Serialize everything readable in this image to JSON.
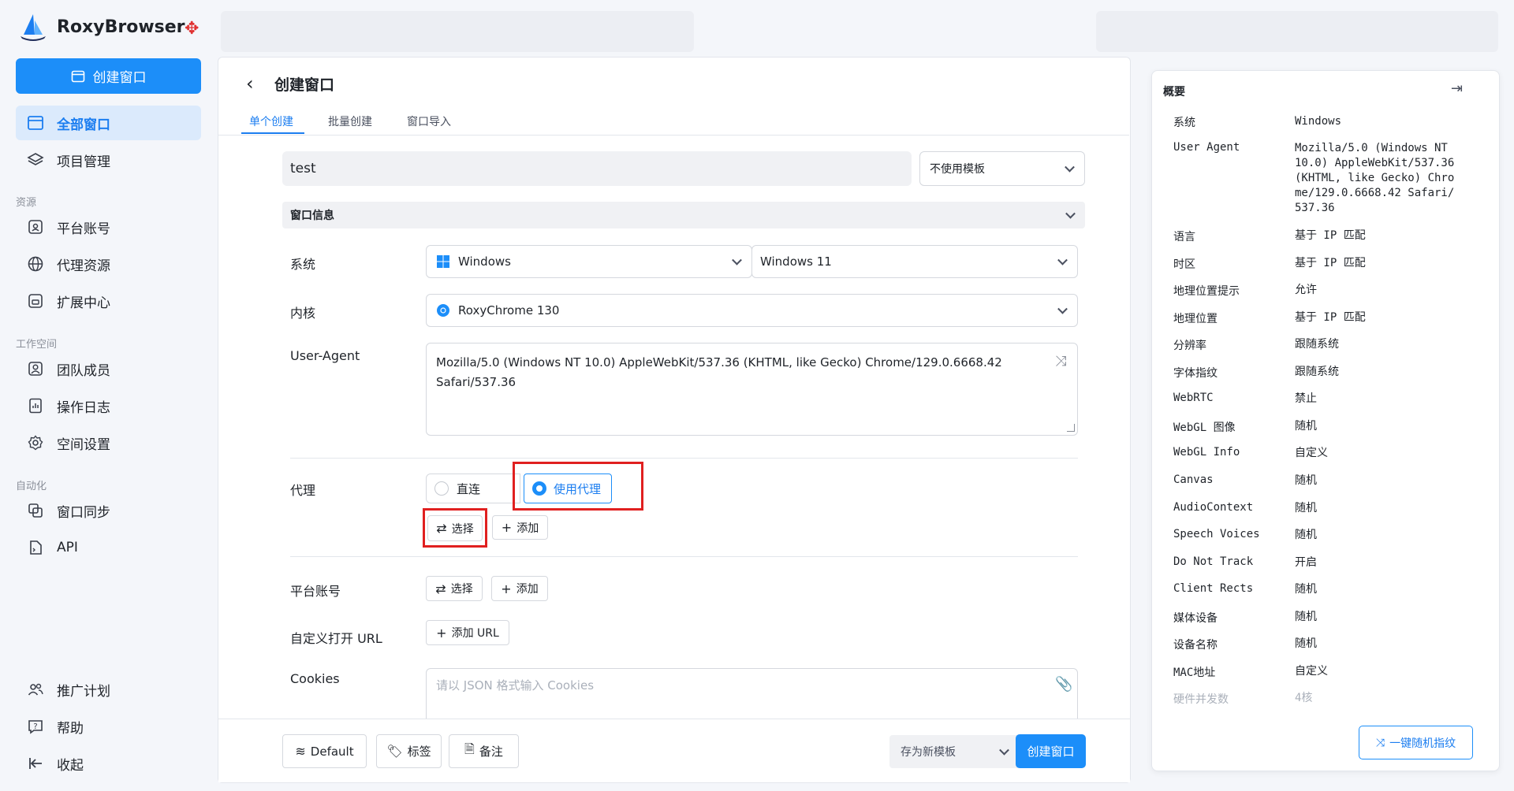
{
  "app": {
    "brand": "RoxyBrowser"
  },
  "sidebar": {
    "create_label": "创建窗口",
    "items": [
      {
        "label": "全部窗口"
      },
      {
        "label": "项目管理"
      },
      {
        "label": "平台账号"
      },
      {
        "label": "代理资源"
      },
      {
        "label": "扩展中心"
      },
      {
        "label": "团队成员"
      },
      {
        "label": "操作日志"
      },
      {
        "label": "空间设置"
      },
      {
        "label": "窗口同步"
      },
      {
        "label": "API"
      },
      {
        "label": "推广计划"
      },
      {
        "label": "帮助"
      },
      {
        "label": "收起"
      }
    ],
    "sections": [
      "资源",
      "工作空间",
      "自动化"
    ]
  },
  "page": {
    "title": "创建窗口",
    "tabs": [
      "单个创建",
      "批量创建",
      "窗口导入"
    ]
  },
  "form": {
    "name_value": "test",
    "template": "不使用模板",
    "section_title": "窗口信息",
    "labels": {
      "system": "系统",
      "kernel": "内核",
      "ua": "User-Agent",
      "proxy": "代理",
      "platform": "平台账号",
      "url": "自定义打开 URL",
      "cookies": "Cookies"
    },
    "os": "Windows",
    "os_version": "Windows 11",
    "kernel": "RoxyChrome 130",
    "ua_value": "Mozilla/5.0 (Windows NT 10.0) AppleWebKit/537.36 (KHTML, like Gecko) Chrome/129.0.6668.42 Safari/537.36",
    "proxy_direct": "直连",
    "proxy_use": "使用代理",
    "select_label": "选择",
    "add_label": "添加",
    "add_url_label": "添加 URL",
    "cookies_placeholder": "请以 JSON 格式输入 Cookies"
  },
  "footer": {
    "default_label": "Default",
    "tag_label": "标签",
    "note_label": "备注",
    "save_template": "存为新模板",
    "create_label": "创建窗口"
  },
  "summary": {
    "title": "概要",
    "rows": [
      {
        "k": "系统",
        "v": "Windows"
      },
      {
        "k": "User Agent",
        "v": "Mozilla/5.0 (Windows NT 10.0) AppleWebKit/537.36 (KHTML, like Gecko) Chrome/129.0.6668.42 Safari/537.36"
      },
      {
        "k": "语言",
        "v": "基于 IP 匹配"
      },
      {
        "k": "时区",
        "v": "基于 IP 匹配"
      },
      {
        "k": "地理位置提示",
        "v": "允许"
      },
      {
        "k": "地理位置",
        "v": "基于 IP 匹配"
      },
      {
        "k": "分辨率",
        "v": "跟随系统"
      },
      {
        "k": "字体指纹",
        "v": "跟随系统"
      },
      {
        "k": "WebRTC",
        "v": "禁止"
      },
      {
        "k": "WebGL 图像",
        "v": "随机"
      },
      {
        "k": "WebGL Info",
        "v": "自定义"
      },
      {
        "k": "Canvas",
        "v": "随机"
      },
      {
        "k": "AudioContext",
        "v": "随机"
      },
      {
        "k": "Speech Voices",
        "v": "随机"
      },
      {
        "k": "Do Not Track",
        "v": "开启"
      },
      {
        "k": "Client Rects",
        "v": "随机"
      },
      {
        "k": "媒体设备",
        "v": "随机"
      },
      {
        "k": "设备名称",
        "v": "随机"
      },
      {
        "k": "MAC地址",
        "v": "自定义"
      },
      {
        "k": "硬件并发数",
        "v": "4核"
      }
    ],
    "random_label": "一键随机指纹"
  },
  "colors": {
    "accent": "#1c8ef9",
    "highlight": "#e02020"
  }
}
